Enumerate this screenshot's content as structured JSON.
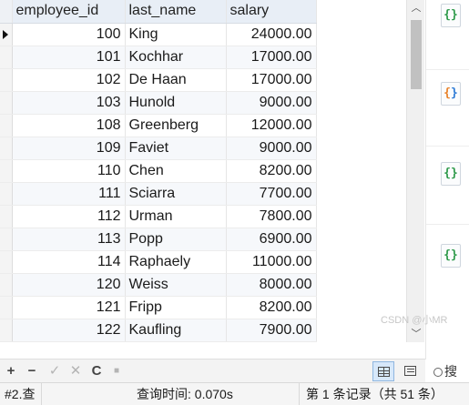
{
  "grid": {
    "columns": [
      "employee_id",
      "last_name",
      "salary"
    ],
    "rows": [
      {
        "employee_id": "100",
        "last_name": "King",
        "salary": "24000.00"
      },
      {
        "employee_id": "101",
        "last_name": "Kochhar",
        "salary": "17000.00"
      },
      {
        "employee_id": "102",
        "last_name": "De Haan",
        "salary": "17000.00"
      },
      {
        "employee_id": "103",
        "last_name": "Hunold",
        "salary": "9000.00"
      },
      {
        "employee_id": "108",
        "last_name": "Greenberg",
        "salary": "12000.00"
      },
      {
        "employee_id": "109",
        "last_name": "Faviet",
        "salary": "9000.00"
      },
      {
        "employee_id": "110",
        "last_name": "Chen",
        "salary": "8200.00"
      },
      {
        "employee_id": "111",
        "last_name": "Sciarra",
        "salary": "7700.00"
      },
      {
        "employee_id": "112",
        "last_name": "Urman",
        "salary": "7800.00"
      },
      {
        "employee_id": "113",
        "last_name": "Popp",
        "salary": "6900.00"
      },
      {
        "employee_id": "114",
        "last_name": "Raphaely",
        "salary": "11000.00"
      },
      {
        "employee_id": "120",
        "last_name": "Weiss",
        "salary": "8000.00"
      },
      {
        "employee_id": "121",
        "last_name": "Fripp",
        "salary": "8200.00"
      },
      {
        "employee_id": "122",
        "last_name": "Kaufling",
        "salary": "7900.00"
      }
    ]
  },
  "toolbar": {
    "add": "+",
    "remove": "−",
    "apply": "✓",
    "discard": "✕",
    "refresh": "C",
    "stop": "■"
  },
  "right_panel": {
    "cards": [
      "{}",
      "{}",
      "{}",
      "{}"
    ],
    "search_label": "搜索"
  },
  "status": {
    "query_tab": "#2.查",
    "query_time": "查询时间: 0.070s",
    "record_info": "第 1 条记录（共 51 条）"
  },
  "watermark": "CSDN @小MR",
  "colors": {
    "header_bg": "#e8eef6",
    "alt_row_bg": "#f6f8fb",
    "selected_view": "#d7e8fa"
  }
}
